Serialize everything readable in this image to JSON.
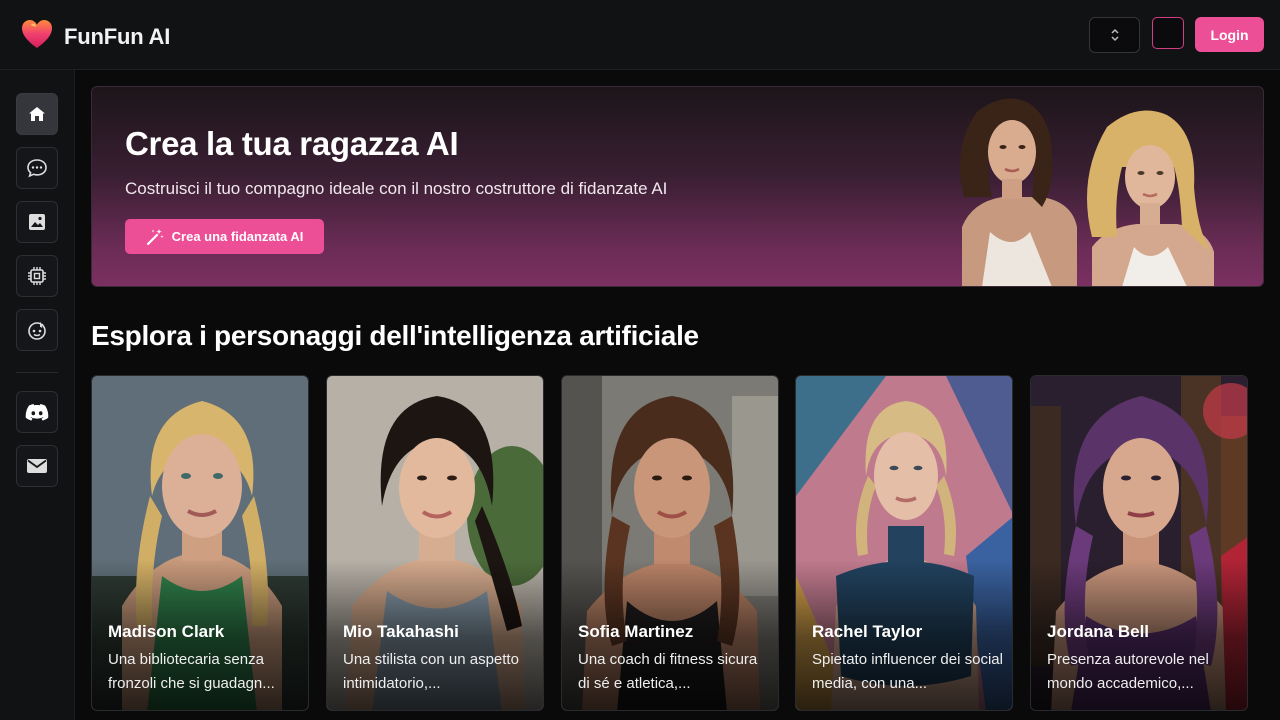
{
  "header": {
    "brand": "FunFun AI",
    "login_label": "Login"
  },
  "sidebar": {
    "items": [
      {
        "icon": "home-icon",
        "active": true
      },
      {
        "icon": "chat-icon",
        "active": false
      },
      {
        "icon": "image-icon",
        "active": false
      },
      {
        "icon": "chip-icon",
        "active": false
      },
      {
        "icon": "character-icon",
        "active": false
      },
      {
        "icon": "discord-icon",
        "active": false
      },
      {
        "icon": "mail-icon",
        "active": false
      }
    ]
  },
  "banner": {
    "title": "Crea la tua ragazza AI",
    "subtitle": "Costruisci il tuo compagno ideale con il nostro costruttore di fidanzate AI",
    "button_label": "Crea una fidanzata AI"
  },
  "section": {
    "title": "Esplora i personaggi dell'intelligenza artificiale"
  },
  "cards": [
    {
      "name": "Madison Clark",
      "desc": "Una bibliotecaria senza fronzoli che si guadagn..."
    },
    {
      "name": "Mio Takahashi",
      "desc": "Una stilista con un aspetto intimidatorio,..."
    },
    {
      "name": "Sofia Martinez",
      "desc": "Una coach di fitness sicura di sé e atletica,..."
    },
    {
      "name": "Rachel Taylor",
      "desc": "Spietato influencer dei social media, con una..."
    },
    {
      "name": "Jordana Bell",
      "desc": "Presenza autorevole nel mondo accademico,..."
    }
  ],
  "colors": {
    "accent": "#ec4f96",
    "background": "#0a0a0b",
    "panel": "#111214"
  }
}
